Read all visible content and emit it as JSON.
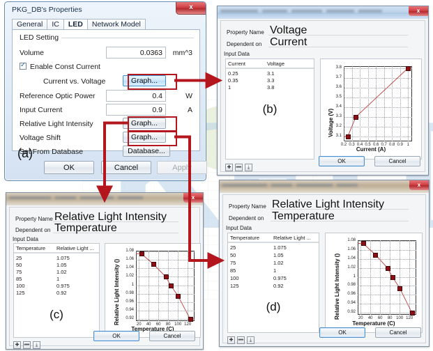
{
  "panel_a": {
    "title": "PKG_DB's Properties",
    "close_label": "x",
    "caption": "(a)",
    "tabs": [
      {
        "label": "General",
        "selected": false
      },
      {
        "label": "IC",
        "selected": false
      },
      {
        "label": "LED",
        "selected": true
      },
      {
        "label": "Network Model",
        "selected": false
      }
    ],
    "group_label": "LED Setting",
    "rows": [
      {
        "label": "Volume",
        "value": "0.0363",
        "unit": "mm^3",
        "kind": "field"
      },
      {
        "label": "Enable Const Current",
        "kind": "checkbox",
        "checked": true
      },
      {
        "label": "Current vs. Voltage",
        "button": "Graph...",
        "kind": "button",
        "indent": true,
        "highlight": true
      },
      {
        "label": "Reference Optic Power",
        "value": "0.4",
        "unit": "W",
        "kind": "field"
      },
      {
        "label": "Input Current",
        "value": "0.9",
        "unit": "A",
        "kind": "field"
      },
      {
        "label": "Relative Light Intensity",
        "button": "Graph...",
        "kind": "button"
      },
      {
        "label": "Voltage Shift",
        "button": "Graph...",
        "kind": "button"
      },
      {
        "label": "Set From Database",
        "button": "Database...",
        "kind": "button"
      }
    ],
    "buttons": {
      "ok": "OK",
      "cancel": "Cancel",
      "apply": "Apply"
    }
  },
  "panel_b": {
    "caption": "(b)",
    "close_label": "x",
    "property_name_label": "Property Name",
    "property_name_value": "Voltage",
    "dependent_label": "Dependent on",
    "dependent_value": "Current",
    "input_data_label": "Input Data",
    "columns": [
      "Current",
      "Voltage"
    ],
    "rows": [
      [
        "0.25",
        "3.1"
      ],
      [
        "0.35",
        "3.3"
      ],
      [
        "1",
        "3.8"
      ]
    ],
    "mini_buttons": [
      "add-row",
      "remove-row",
      "import"
    ],
    "mini_glyphs": [
      "✚",
      "➖",
      "⤓"
    ],
    "ok": "OK",
    "cancel": "Cancel"
  },
  "panel_c": {
    "caption": "(c)",
    "close_label": "x",
    "property_name_label": "Property Name",
    "property_name_value": "Relative Light Intensity",
    "dependent_label": "Dependent on",
    "dependent_value": "Temperature",
    "input_data_label": "Input Data",
    "columns": [
      "Temperature",
      "Relative Light ..."
    ],
    "rows": [
      [
        "25",
        "1.075"
      ],
      [
        "50",
        "1.05"
      ],
      [
        "75",
        "1.02"
      ],
      [
        "85",
        "1"
      ],
      [
        "100",
        "0.975"
      ],
      [
        "125",
        "0.92"
      ]
    ],
    "mini_glyphs": [
      "✚",
      "➖",
      "⤓"
    ],
    "ok": "OK",
    "cancel": "Cancel"
  },
  "panel_d": {
    "caption": "(d)",
    "close_label": "x",
    "property_name_label": "Property Name",
    "property_name_value": "Relative Light Intensity",
    "dependent_label": "Dependent on",
    "dependent_value": "Temperature",
    "input_data_label": "Input Data",
    "columns": [
      "Temperature",
      "Relative Light ..."
    ],
    "rows": [
      [
        "25",
        "1.075"
      ],
      [
        "50",
        "1.05"
      ],
      [
        "75",
        "1.02"
      ],
      [
        "85",
        "1"
      ],
      [
        "100",
        "0.975"
      ],
      [
        "125",
        "0.92"
      ]
    ],
    "mini_glyphs": [
      "✚",
      "➖",
      "⤓"
    ],
    "ok": "OK",
    "cancel": "Cancel"
  },
  "watermark": {
    "text": "KEIT"
  },
  "colors": {
    "annotation_red": "#b3161c",
    "marker_red": "#8b0f14",
    "line_red": "#c0504d",
    "titlebar_blue": "#bdd3ea",
    "accent_blue": "#3f8fd0"
  },
  "chart_data": [
    {
      "id": "chart-b",
      "type": "line",
      "title": "",
      "xlabel": "Current (A)",
      "ylabel": "Voltage (V)",
      "x": [
        0.25,
        0.35,
        1
      ],
      "values": [
        3.1,
        3.3,
        3.8
      ],
      "xlim": [
        0.2,
        1.05
      ],
      "ylim": [
        3.05,
        3.82
      ],
      "xticks": [
        0.2,
        0.3,
        0.4,
        0.5,
        0.6,
        0.7,
        0.8,
        0.9,
        1
      ],
      "xticklabels": [
        "0.2",
        "0.3",
        "0.4",
        "0.5",
        "0.6",
        "0.7",
        "0.8",
        "0.9",
        "1"
      ],
      "yticks": [
        3.1,
        3.2,
        3.3,
        3.4,
        3.5,
        3.6,
        3.7,
        3.8
      ],
      "yticklabels": [
        "3.1",
        "3.2",
        "3.3",
        "3.4",
        "3.5",
        "3.6",
        "3.7",
        "3.8"
      ],
      "grid": true,
      "legend": "none"
    },
    {
      "id": "chart-c",
      "type": "line",
      "title": "",
      "xlabel": "Temperature (C)",
      "ylabel": "Relative Light Intensity ()",
      "x": [
        25,
        50,
        75,
        85,
        100,
        125
      ],
      "values": [
        1.075,
        1.05,
        1.02,
        1,
        0.975,
        0.92
      ],
      "xlim": [
        14,
        134
      ],
      "ylim": [
        0.915,
        1.082
      ],
      "xticks": [
        20,
        40,
        60,
        80,
        100,
        120
      ],
      "xticklabels": [
        "20",
        "40",
        "60",
        "80",
        "100",
        "120"
      ],
      "yticks": [
        0.92,
        0.94,
        0.96,
        0.98,
        1,
        1.02,
        1.04,
        1.06,
        1.08
      ],
      "yticklabels": [
        "0.92",
        "0.94",
        "0.96",
        "0.98",
        "1",
        "1.02",
        "1.04",
        "1.06",
        "1.08"
      ],
      "grid": true,
      "legend": "none"
    },
    {
      "id": "chart-d",
      "type": "line",
      "title": "",
      "xlabel": "Temperature (C)",
      "ylabel": "Relative Light Intensity ()",
      "x": [
        25,
        50,
        75,
        85,
        100,
        125
      ],
      "values": [
        1.075,
        1.05,
        1.02,
        1,
        0.975,
        0.92
      ],
      "xlim": [
        14,
        134
      ],
      "ylim": [
        0.915,
        1.082
      ],
      "xticks": [
        20,
        40,
        60,
        80,
        100,
        120
      ],
      "xticklabels": [
        "20",
        "40",
        "60",
        "80",
        "100",
        "120"
      ],
      "yticks": [
        0.92,
        0.94,
        0.96,
        0.98,
        1,
        1.02,
        1.04,
        1.06,
        1.08
      ],
      "yticklabels": [
        "0.92",
        "0.94",
        "0.96",
        "0.98",
        "1",
        "1.02",
        "1.04",
        "1.06",
        "1.08"
      ],
      "grid": true,
      "legend": "none"
    }
  ]
}
